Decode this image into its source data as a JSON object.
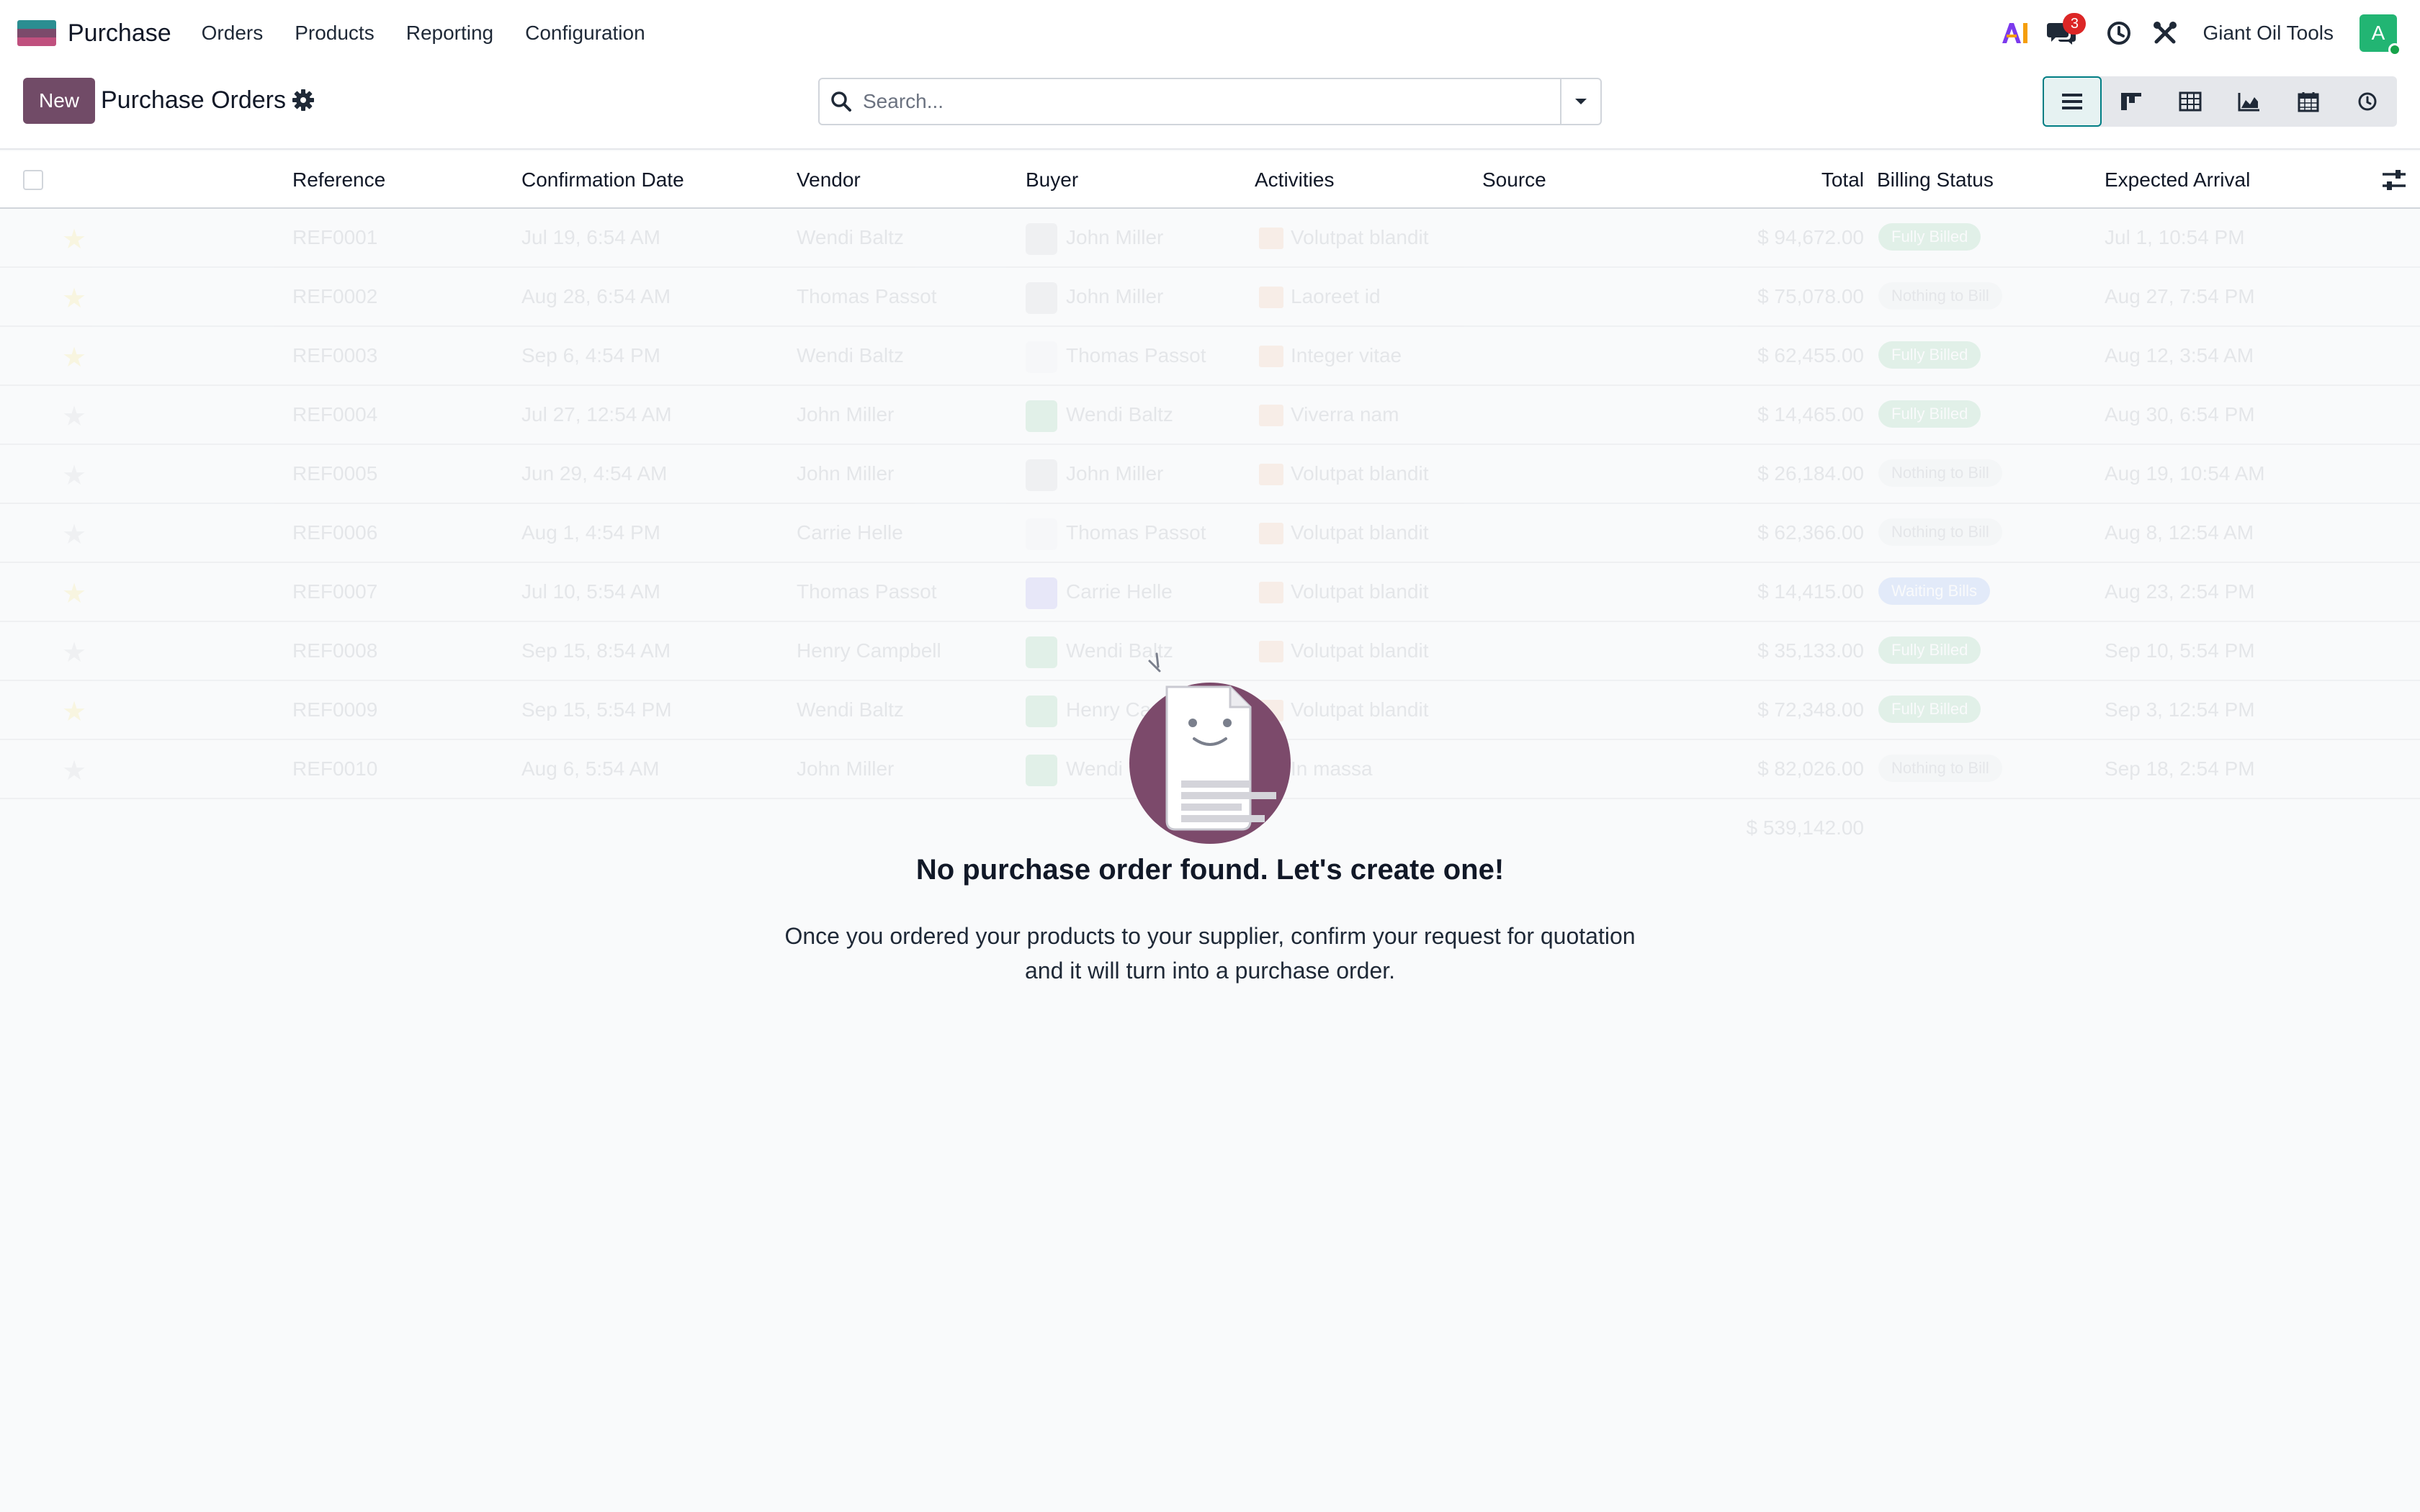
{
  "navbar": {
    "app_name": "Purchase",
    "menu": [
      "Orders",
      "Products",
      "Reporting",
      "Configuration"
    ],
    "ai_label": "AI",
    "messages_badge": "3",
    "company": "Giant Oil Tools",
    "avatar_initial": "A"
  },
  "control": {
    "new_label": "New",
    "title": "Purchase Orders",
    "search_placeholder": "Search...",
    "views": [
      "list-view",
      "kanban-view",
      "pivot-view",
      "graph-view",
      "calendar-view",
      "activity-view"
    ],
    "active_view": "list-view"
  },
  "columns": {
    "reference": "Reference",
    "confirmation_date": "Confirmation Date",
    "vendor": "Vendor",
    "buyer": "Buyer",
    "activities": "Activities",
    "source": "Source",
    "total": "Total",
    "billing_status": "Billing Status",
    "expected_arrival": "Expected Arrival"
  },
  "rows": [
    {
      "ref": "REF0001",
      "date": "Jul 19, 6:54 AM",
      "vendor": "Wendi Baltz",
      "buyer": "John Miller",
      "activity": "Volutpat blandit",
      "total": "$ 94,672.00",
      "status": "Fully Billed",
      "status_type": "green",
      "arrival": "Jul 1, 10:54 PM",
      "star": true,
      "avatar_color": "#9ca3af"
    },
    {
      "ref": "REF0002",
      "date": "Aug 28, 6:54 AM",
      "vendor": "Thomas Passot",
      "buyer": "John Miller",
      "activity": "Laoreet id",
      "total": "$ 75,078.00",
      "status": "Nothing to Bill",
      "status_type": "grey",
      "arrival": "Aug 27, 7:54 PM",
      "star": true,
      "avatar_color": "#9ca3af"
    },
    {
      "ref": "REF0003",
      "date": "Sep 6, 4:54 PM",
      "vendor": "Wendi Baltz",
      "buyer": "Thomas Passot",
      "activity": "Integer vitae",
      "total": "$ 62,455.00",
      "status": "Fully Billed",
      "status_type": "green",
      "arrival": "Aug 12, 3:54 AM",
      "star": true,
      "avatar_color": "#e5e7eb"
    },
    {
      "ref": "REF0004",
      "date": "Jul 27, 12:54 AM",
      "vendor": "John Miller",
      "buyer": "Wendi Baltz",
      "activity": "Viverra nam",
      "total": "$ 14,465.00",
      "status": "Fully Billed",
      "status_type": "green",
      "arrival": "Aug 30, 6:54 PM",
      "star": false,
      "avatar_color": "#16a34a"
    },
    {
      "ref": "REF0005",
      "date": "Jun 29, 4:54 AM",
      "vendor": "John Miller",
      "buyer": "John Miller",
      "activity": "Volutpat blandit",
      "total": "$ 26,184.00",
      "status": "Nothing to Bill",
      "status_type": "grey",
      "arrival": "Aug 19, 10:54 AM",
      "star": false,
      "avatar_color": "#9ca3af"
    },
    {
      "ref": "REF0006",
      "date": "Aug 1, 4:54 PM",
      "vendor": "Carrie Helle",
      "buyer": "Thomas Passot",
      "activity": "Volutpat blandit",
      "total": "$ 62,366.00",
      "status": "Nothing to Bill",
      "status_type": "grey",
      "arrival": "Aug 8, 12:54 AM",
      "star": false,
      "avatar_color": "#e5e7eb"
    },
    {
      "ref": "REF0007",
      "date": "Jul 10, 5:54 AM",
      "vendor": "Thomas Passot",
      "buyer": "Carrie Helle",
      "activity": "Volutpat blandit",
      "total": "$ 14,415.00",
      "status": "Waiting Bills",
      "status_type": "blue",
      "arrival": "Aug 23, 2:54 PM",
      "star": true,
      "avatar_color": "#4f46e5"
    },
    {
      "ref": "REF0008",
      "date": "Sep 15, 8:54 AM",
      "vendor": "Henry Campbell",
      "buyer": "Wendi Baltz",
      "activity": "Volutpat blandit",
      "total": "$ 35,133.00",
      "status": "Fully Billed",
      "status_type": "green",
      "arrival": "Sep 10, 5:54 PM",
      "star": false,
      "avatar_color": "#16a34a"
    },
    {
      "ref": "REF0009",
      "date": "Sep 15, 5:54 PM",
      "vendor": "Wendi Baltz",
      "buyer": "Henry Campbell",
      "activity": "Volutpat blandit",
      "total": "$ 72,348.00",
      "status": "Fully Billed",
      "status_type": "green",
      "arrival": "Sep 3, 12:54 PM",
      "star": true,
      "avatar_color": "#16a34a"
    },
    {
      "ref": "REF0010",
      "date": "Aug 6, 5:54 AM",
      "vendor": "John Miller",
      "buyer": "Wendi Baltz",
      "activity": "In massa",
      "total": "$ 82,026.00",
      "status": "Nothing to Bill",
      "status_type": "grey",
      "arrival": "Sep 18, 2:54 PM",
      "star": false,
      "avatar_color": "#16a34a"
    }
  ],
  "sum_total": "$ 539,142.00",
  "empty_state": {
    "title": "No purchase order found. Let's create one!",
    "text": "Once you ordered your products to your supplier, confirm your request for quotation and it will turn into a purchase order."
  },
  "colors": {
    "brand": "#714b67",
    "accent": "#017e84",
    "star": "#f3cc00"
  }
}
